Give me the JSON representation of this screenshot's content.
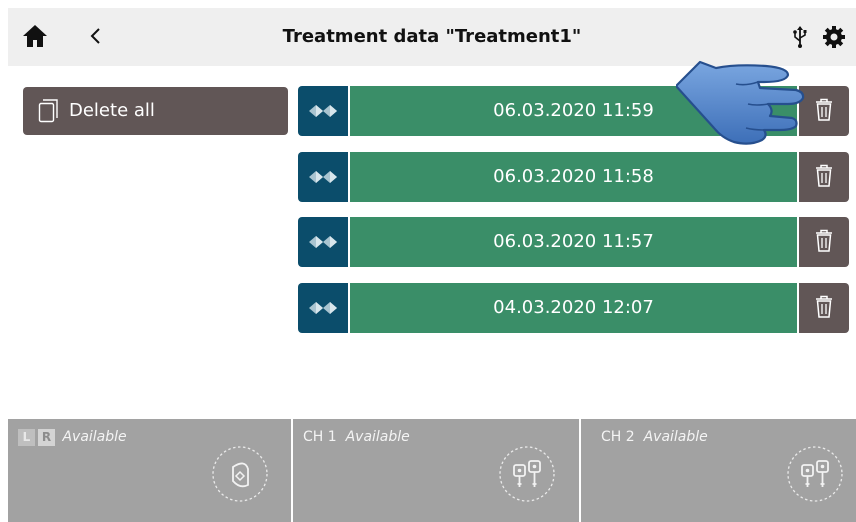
{
  "header": {
    "title": "Treatment data \"Treatment1\"",
    "home_icon": "home-icon",
    "back_icon": "chevron-left-icon",
    "usb_icon": "usb-icon",
    "settings_icon": "gear-icon"
  },
  "delete_all": {
    "label": "Delete all",
    "icon": "document-icon"
  },
  "treatments": [
    {
      "date": "06.03.2020 11:59"
    },
    {
      "date": "06.03.2020 11:58"
    },
    {
      "date": "06.03.2020 11:57"
    },
    {
      "date": "04.03.2020 12:07"
    }
  ],
  "panels": {
    "lr": {
      "badge_l": "L",
      "badge_r": "R",
      "status": "Available"
    },
    "ch1": {
      "label": "CH 1",
      "status": "Available"
    },
    "ch2": {
      "label": "CH 2",
      "status": "Available"
    }
  },
  "colors": {
    "header_bg": "#efefef",
    "type_button": "#0b4d6b",
    "entry_green": "#3a8e68",
    "trash_bg": "#615656",
    "panel_bg": "#a2a2a2",
    "hand_cursor": "#4a7fc8"
  }
}
